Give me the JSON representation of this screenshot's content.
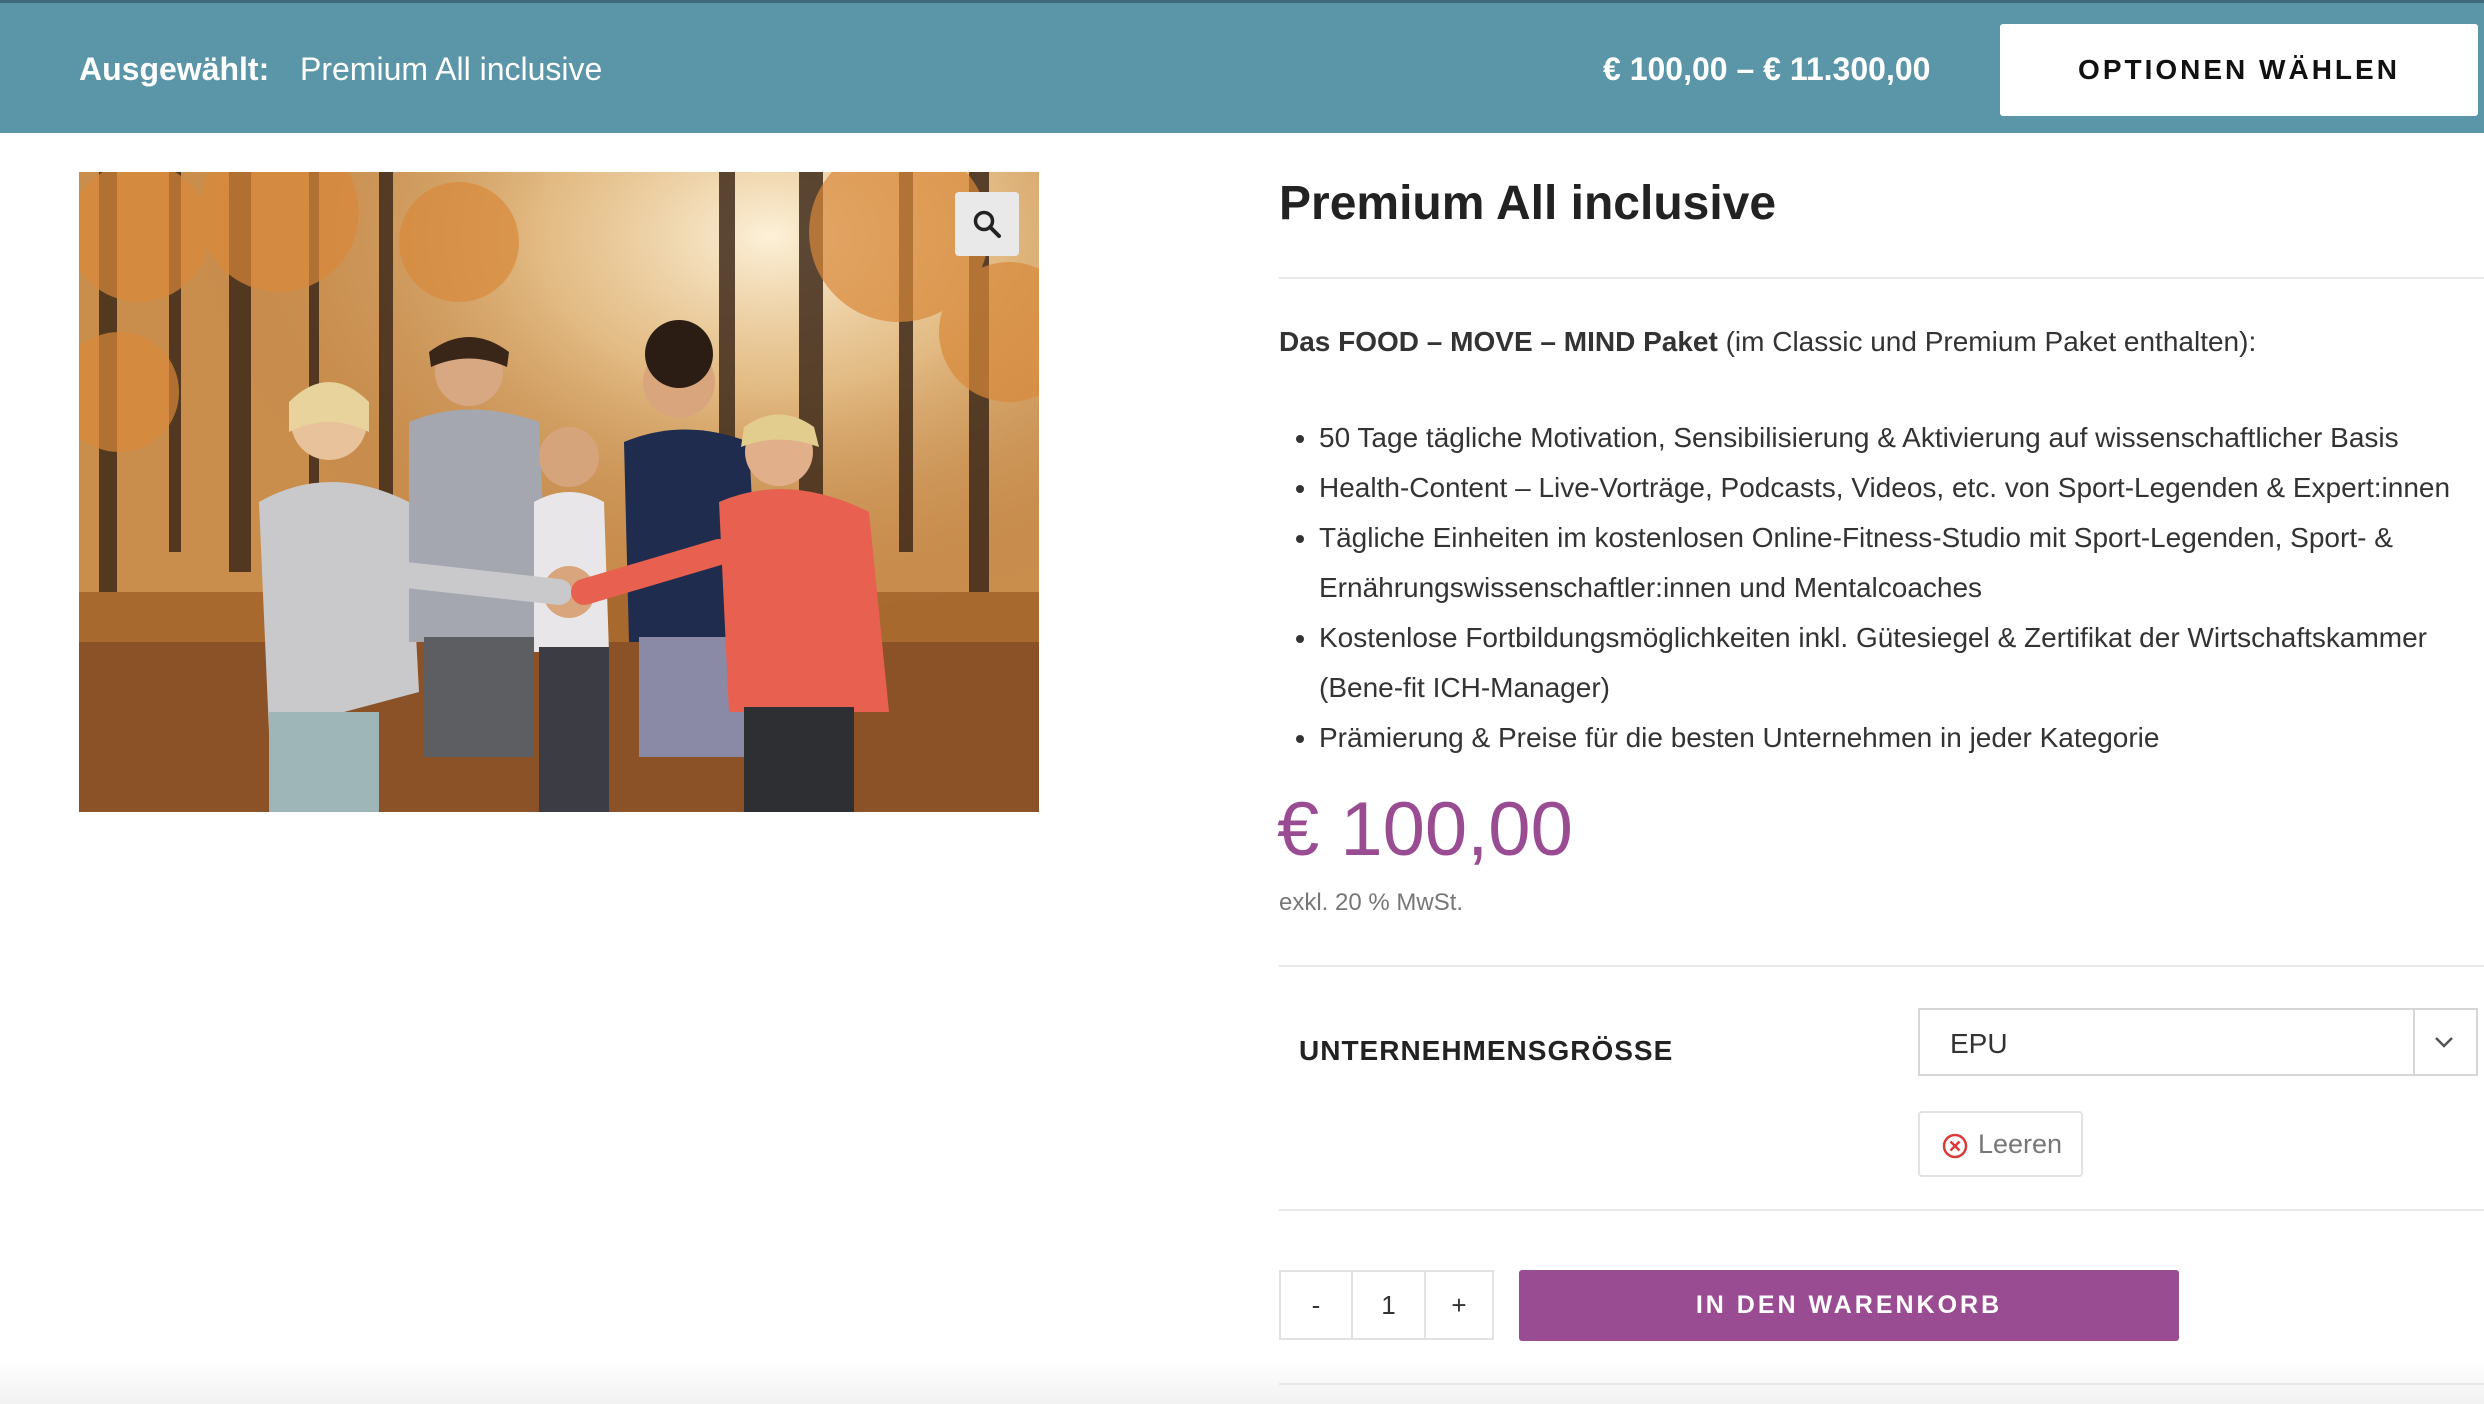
{
  "topbar": {
    "selected_label": "Ausgewählt:",
    "selected_value": "Premium All inclusive",
    "price_range": "€ 100,00 – € 11.300,00",
    "options_button": "OPTIONEN WÄHLEN",
    "bar_color": "#5a95a8"
  },
  "product": {
    "image_alt_icon": "photo-image",
    "zoom_icon": "search-icon",
    "title": "Premium All inclusive",
    "intro_bold": "Das FOOD – MOVE – MIND Paket",
    "intro_rest": " (im Classic und Premium Paket enthalten):",
    "features": [
      "50 Tage tägliche Motivation, Sensibilisierung & Aktivierung auf wissenschaftlicher Basis",
      "Health-Content – Live-Vorträge, Podcasts, Videos, etc. von Sport-Legenden & Expert:innen",
      "Tägliche Einheiten im kostenlosen Online-Fitness-Studio mit Sport-Legenden, Sport- & Ernährungswissenschaftler:innen und Mentalcoaches",
      "Kostenlose Fortbildungsmöglichkeiten inkl. Gütesiegel & Zertifikat der Wirtschaftskammer (Bene-fit ICH-Manager)",
      "Prämierung & Preise für die besten Unternehmen in jeder Kategorie"
    ],
    "price": "€ 100,00",
    "price_color": "#9a4c93",
    "vat_note": "exkl. 20 % MwSt."
  },
  "variation": {
    "label": "UNTERNEHMENSGRÖSSE",
    "selected": "EPU",
    "clear_label": "Leeren",
    "clear_icon": "close-circle-icon"
  },
  "cart": {
    "minus": "-",
    "quantity": "1",
    "plus": "+",
    "add_to_cart": "IN DEN WARENKORB"
  }
}
